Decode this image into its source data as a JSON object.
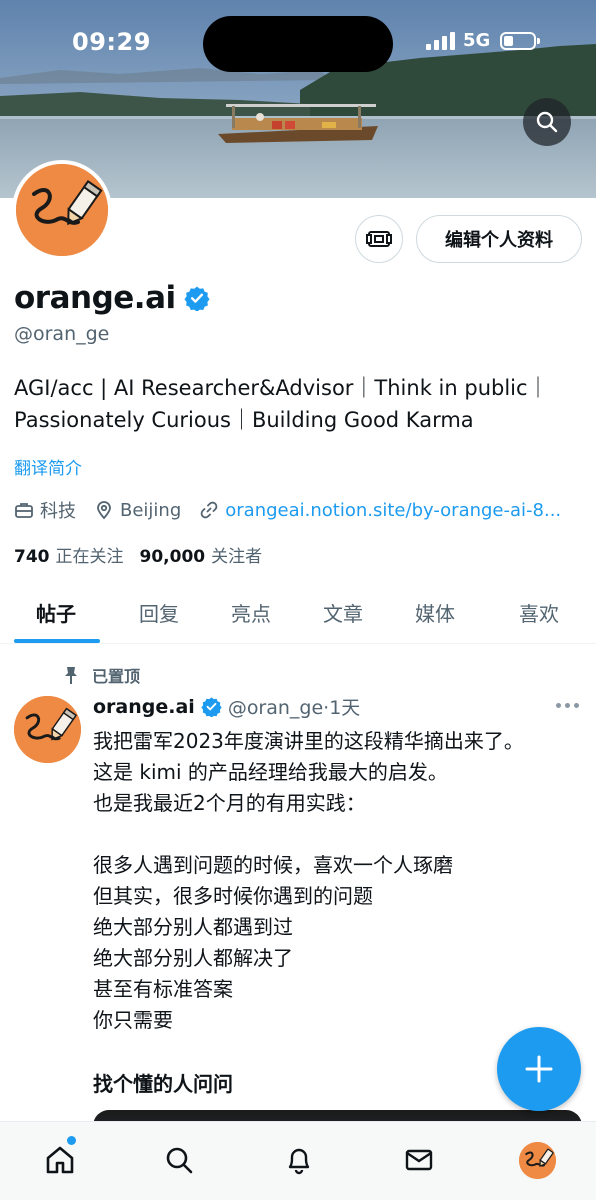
{
  "status_bar": {
    "time": "09:29",
    "network": "5G"
  },
  "profile": {
    "display_name": "orange.ai",
    "handle": "@oran_ge",
    "edit_label": "编辑个人资料",
    "bio_line1": "AGI/acc | AI Researcher&Advisor｜Think in public｜",
    "bio_line2": "Passionately Curious｜Building Good Karma",
    "translate_label": "翻译简介",
    "category": "科技",
    "location": "Beijing",
    "link": "orangeai.notion.site/by-orange-ai-8...",
    "following_count": "740",
    "following_label": "正在关注",
    "followers_count": "90,000",
    "followers_label": "关注者"
  },
  "tabs": [
    {
      "label": "帖子"
    },
    {
      "label": "回复"
    },
    {
      "label": "亮点"
    },
    {
      "label": "文章"
    },
    {
      "label": "媒体"
    },
    {
      "label": "喜欢"
    }
  ],
  "post": {
    "pinned_label": "已置顶",
    "name": "orange.ai",
    "handle_time": "@oran_ge·1天",
    "body": "我把雷军2023年度演讲里的这段精华摘出来了。\n这是 kimi 的产品经理给我最大的启发。\n也是我最近2个月的有用实践：\n\n很多人遇到问题的时候，喜欢一个人琢磨\n但其实，很多时候你遇到的问题\n绝大部分别人都遇到过\n绝大部分别人都解决了\n甚至有标准答案\n你只需要",
    "bold_line": "找个懂的人问问"
  },
  "colors": {
    "accent": "#1d9bf0",
    "avatar_orange": "#ee8a44",
    "text": "#0f1419",
    "muted": "#536471"
  },
  "icons": [
    "search-icon",
    "qr-money-icon",
    "verified-badge-icon",
    "briefcase-icon",
    "location-pin-icon",
    "link-icon",
    "pin-icon",
    "plus-icon",
    "home-icon",
    "bell-icon",
    "mail-icon"
  ]
}
